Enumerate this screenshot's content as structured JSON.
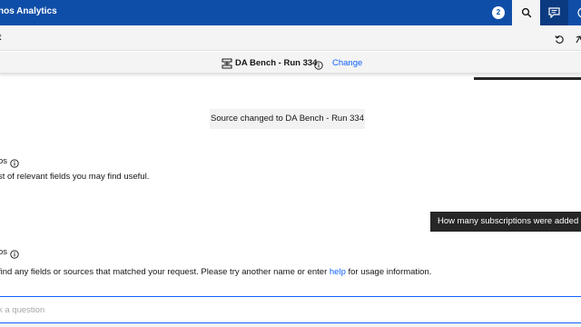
{
  "header": {
    "app_title": "nos Analytics",
    "notification_count": "2",
    "icons": [
      "search-icon",
      "chat-icon",
      "help-icon"
    ]
  },
  "subheader": {
    "label": "t",
    "icons": [
      "reset-icon",
      "collapse-icon"
    ]
  },
  "source": {
    "name": "DA Bench - Run 334",
    "change_label": "Change",
    "icon": "data-module-icon"
  },
  "conversation": {
    "system_message": "Source changed to DA Bench - Run 334",
    "bot_name_1": "os",
    "bot_message_1": "st of relevant fields you may find useful.",
    "user_message": "How many subscriptions were added in",
    "bot_name_2": "os",
    "bot_message_2_before": "find any fields or sources that matched your request. Please try another name or enter ",
    "bot_message_2_link": "help",
    "bot_message_2_after": " for usage information."
  },
  "input": {
    "placeholder": "k a question",
    "value": ""
  },
  "colors": {
    "header_bg": "#0f4ea8",
    "accent": "#0f62fe",
    "user_bubble_bg": "#262626"
  }
}
